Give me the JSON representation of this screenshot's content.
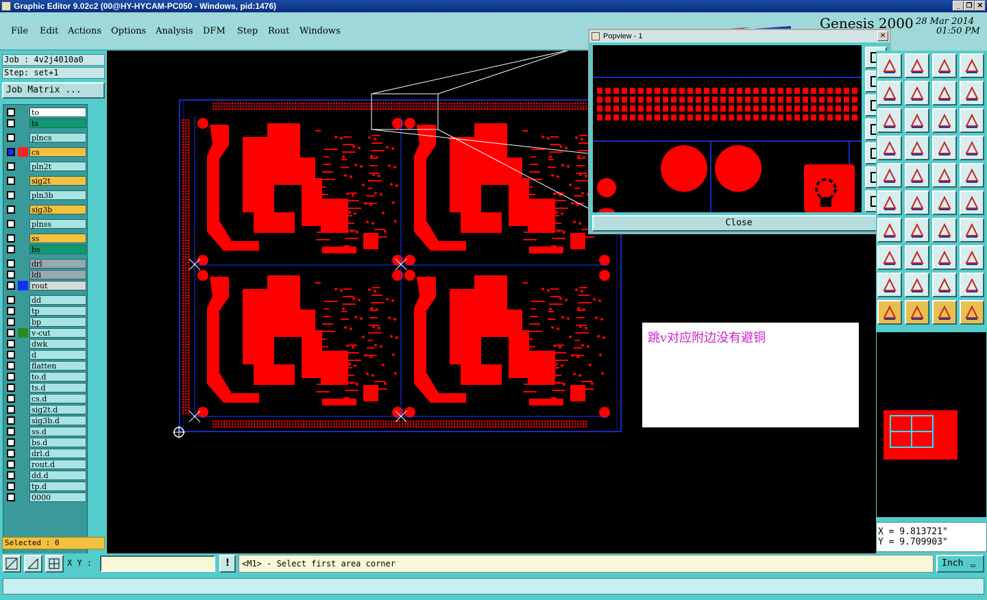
{
  "window": {
    "title": "Graphic Editor 9.02c2 (00@HY-HYCAM-PC050 - Windows, pid:1476)"
  },
  "menu": [
    "File",
    "Edit",
    "Actions",
    "Options",
    "Analysis",
    "DFM",
    "Step",
    "Rout",
    "Windows"
  ],
  "brand": {
    "name": "Genesis 2000",
    "date": "28 Mar 2014",
    "time": "01:50 PM"
  },
  "job": {
    "job_label": "Job : 4v2j4010a0",
    "step_label": "Step: set+1",
    "matrix_button": "Job Matrix ..."
  },
  "layers": [
    {
      "name": "to",
      "color": "#ffffff",
      "swatch": ""
    },
    {
      "name": "ts",
      "color": "#109870",
      "swatch": ""
    },
    {
      "name": "plncs",
      "color": "#a8e4e4",
      "swatch": ""
    },
    {
      "name": "cs",
      "color": "#f4c040",
      "swatch": "#ff2020",
      "active": true
    },
    {
      "name": "pln2t",
      "color": "#a8e4e4",
      "swatch": ""
    },
    {
      "name": "sig2t",
      "color": "#f4c040",
      "swatch": ""
    },
    {
      "name": "pln3b",
      "color": "#a8e4e4",
      "swatch": ""
    },
    {
      "name": "sig3b",
      "color": "#f4c040",
      "swatch": ""
    },
    {
      "name": "plnss",
      "color": "#a8e4e4",
      "swatch": ""
    },
    {
      "name": "ss",
      "color": "#f4c040",
      "swatch": ""
    },
    {
      "name": "bs",
      "color": "#109870",
      "swatch": ""
    },
    {
      "name": "drl",
      "color": "#98a8b0",
      "swatch": ""
    },
    {
      "name": "ldi",
      "color": "#98a8b0",
      "swatch": ""
    },
    {
      "name": "rout",
      "color": "#d8d8d8",
      "swatch": "#1030ff"
    },
    {
      "name": "dd",
      "color": "#a8e4e4",
      "swatch": ""
    },
    {
      "name": "tp",
      "color": "#a8e4e4",
      "swatch": ""
    },
    {
      "name": "bp",
      "color": "#a8e4e4",
      "swatch": ""
    },
    {
      "name": "v-cut",
      "color": "#a8e4e4",
      "swatch": "#2a8a20"
    },
    {
      "name": "dwk",
      "color": "#a8e4e4",
      "swatch": ""
    },
    {
      "name": "d",
      "color": "#a8e4e4",
      "swatch": ""
    },
    {
      "name": "flatten",
      "color": "#a8e4e4",
      "swatch": ""
    },
    {
      "name": "to.d",
      "color": "#a8e4e4",
      "swatch": ""
    },
    {
      "name": "ts.d",
      "color": "#a8e4e4",
      "swatch": ""
    },
    {
      "name": "cs.d",
      "color": "#a8e4e4",
      "swatch": ""
    },
    {
      "name": "sig2t.d",
      "color": "#a8e4e4",
      "swatch": ""
    },
    {
      "name": "sig3b.d",
      "color": "#a8e4e4",
      "swatch": ""
    },
    {
      "name": "ss.d",
      "color": "#a8e4e4",
      "swatch": ""
    },
    {
      "name": "bs.d",
      "color": "#a8e4e4",
      "swatch": ""
    },
    {
      "name": "drl.d",
      "color": "#a8e4e4",
      "swatch": ""
    },
    {
      "name": "rout.d",
      "color": "#a8e4e4",
      "swatch": ""
    },
    {
      "name": "dd.d",
      "color": "#a8e4e4",
      "swatch": ""
    },
    {
      "name": "tp.d",
      "color": "#a8e4e4",
      "swatch": ""
    },
    {
      "name": "0000",
      "color": "#a8e4e4",
      "swatch": ""
    }
  ],
  "selected": "Selected : 0",
  "popview": {
    "title": "Popview - 1",
    "close": "Close"
  },
  "note": "跳v对应附边没有避铜",
  "bottom": {
    "xy_label": "X Y :",
    "xy_value": "",
    "prompt": "<M1> - Select first area corner",
    "unit": "Inch",
    "info_button": "!"
  },
  "coords": {
    "x": "X = 9.813721\"",
    "y": "Y = 9.709903\""
  },
  "colors": {
    "copper": "#ff0000",
    "profile": "#1a3cff",
    "panel": "#55cccc"
  }
}
